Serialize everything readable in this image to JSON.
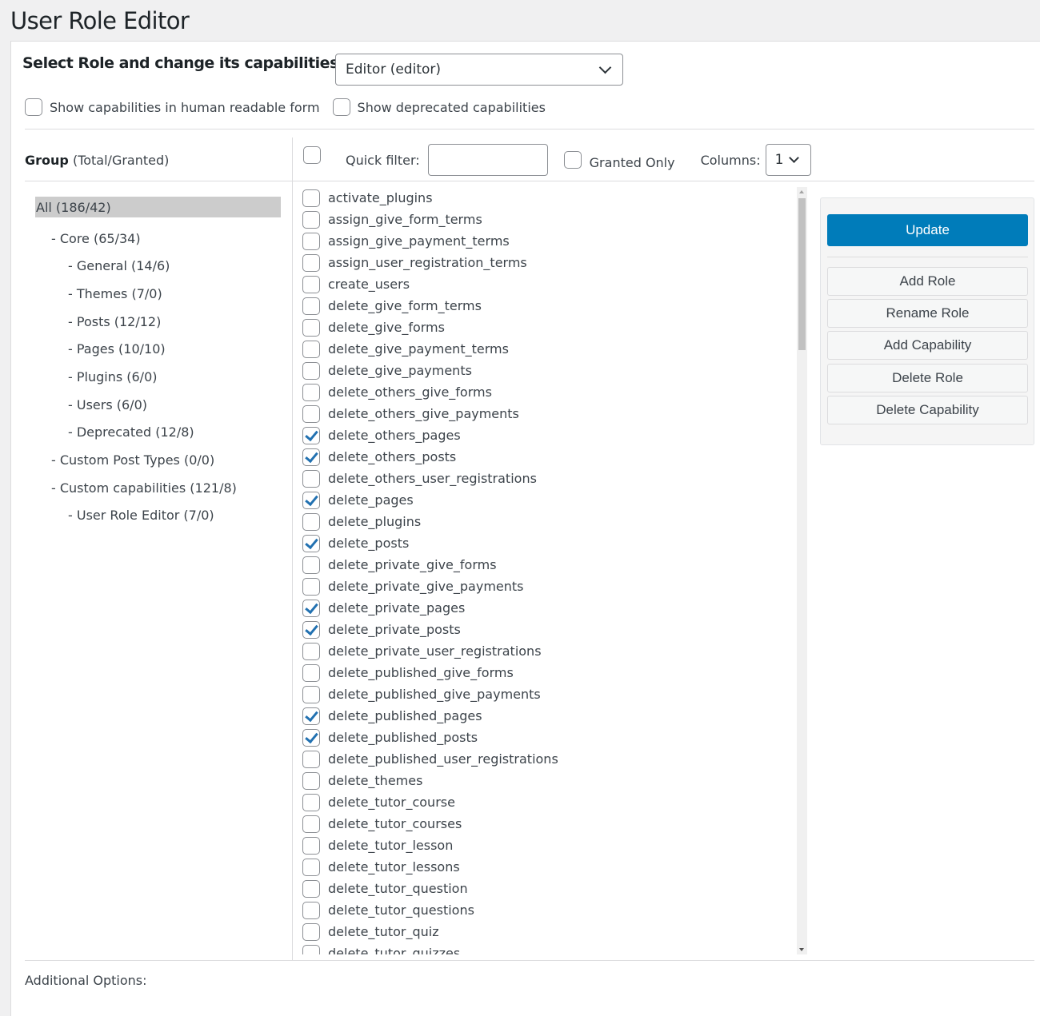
{
  "page_title": "User Role Editor",
  "role_selector": {
    "label": "Select Role and change its capabilities:",
    "selected": "Editor (editor)"
  },
  "options": [
    {
      "label": "Show capabilities in human readable form",
      "checked": false
    },
    {
      "label": "Show deprecated capabilities",
      "checked": false
    }
  ],
  "groups_header": {
    "bold": "Group",
    "rest": " (Total/Granted)"
  },
  "toolbar": {
    "select_all_checked": false,
    "quick_filter_label": "Quick filter:",
    "quick_filter_value": "",
    "granted_only_label": "Granted Only",
    "granted_only_checked": false,
    "columns_label": "Columns:",
    "columns_value": "1"
  },
  "groups": [
    {
      "label": "All (186/42)",
      "level": 0,
      "selected": true
    },
    {
      "label": "- Core (65/34)",
      "level": 1
    },
    {
      "label": "- General (14/6)",
      "level": 2
    },
    {
      "label": "- Themes (7/0)",
      "level": 2
    },
    {
      "label": "- Posts (12/12)",
      "level": 2
    },
    {
      "label": "- Pages (10/10)",
      "level": 2
    },
    {
      "label": "- Plugins (6/0)",
      "level": 2
    },
    {
      "label": "- Users (6/0)",
      "level": 2
    },
    {
      "label": "- Deprecated (12/8)",
      "level": 2
    },
    {
      "label": "- Custom Post Types (0/0)",
      "level": 1
    },
    {
      "label": "- Custom capabilities (121/8)",
      "level": 1
    },
    {
      "label": "- User Role Editor (7/0)",
      "level": 2
    }
  ],
  "capabilities": [
    {
      "name": "activate_plugins",
      "granted": false
    },
    {
      "name": "assign_give_form_terms",
      "granted": false
    },
    {
      "name": "assign_give_payment_terms",
      "granted": false
    },
    {
      "name": "assign_user_registration_terms",
      "granted": false
    },
    {
      "name": "create_users",
      "granted": false
    },
    {
      "name": "delete_give_form_terms",
      "granted": false
    },
    {
      "name": "delete_give_forms",
      "granted": false
    },
    {
      "name": "delete_give_payment_terms",
      "granted": false
    },
    {
      "name": "delete_give_payments",
      "granted": false
    },
    {
      "name": "delete_others_give_forms",
      "granted": false
    },
    {
      "name": "delete_others_give_payments",
      "granted": false
    },
    {
      "name": "delete_others_pages",
      "granted": true
    },
    {
      "name": "delete_others_posts",
      "granted": true
    },
    {
      "name": "delete_others_user_registrations",
      "granted": false
    },
    {
      "name": "delete_pages",
      "granted": true
    },
    {
      "name": "delete_plugins",
      "granted": false
    },
    {
      "name": "delete_posts",
      "granted": true
    },
    {
      "name": "delete_private_give_forms",
      "granted": false
    },
    {
      "name": "delete_private_give_payments",
      "granted": false
    },
    {
      "name": "delete_private_pages",
      "granted": true
    },
    {
      "name": "delete_private_posts",
      "granted": true
    },
    {
      "name": "delete_private_user_registrations",
      "granted": false
    },
    {
      "name": "delete_published_give_forms",
      "granted": false
    },
    {
      "name": "delete_published_give_payments",
      "granted": false
    },
    {
      "name": "delete_published_pages",
      "granted": true
    },
    {
      "name": "delete_published_posts",
      "granted": true
    },
    {
      "name": "delete_published_user_registrations",
      "granted": false
    },
    {
      "name": "delete_themes",
      "granted": false
    },
    {
      "name": "delete_tutor_course",
      "granted": false
    },
    {
      "name": "delete_tutor_courses",
      "granted": false
    },
    {
      "name": "delete_tutor_lesson",
      "granted": false
    },
    {
      "name": "delete_tutor_lessons",
      "granted": false
    },
    {
      "name": "delete_tutor_question",
      "granted": false
    },
    {
      "name": "delete_tutor_questions",
      "granted": false
    },
    {
      "name": "delete_tutor_quiz",
      "granted": false
    },
    {
      "name": "delete_tutor_quizzes",
      "granted": false
    }
  ],
  "actions": {
    "update": "Update",
    "add_role": "Add Role",
    "rename_role": "Rename Role",
    "add_capability": "Add Capability",
    "delete_role": "Delete Role",
    "delete_capability": "Delete Capability"
  },
  "additional_options_label": "Additional Options:",
  "colors": {
    "primary": "#007cba",
    "checkmark": "#2271b1",
    "selected_group_bg": "#cccccc"
  }
}
